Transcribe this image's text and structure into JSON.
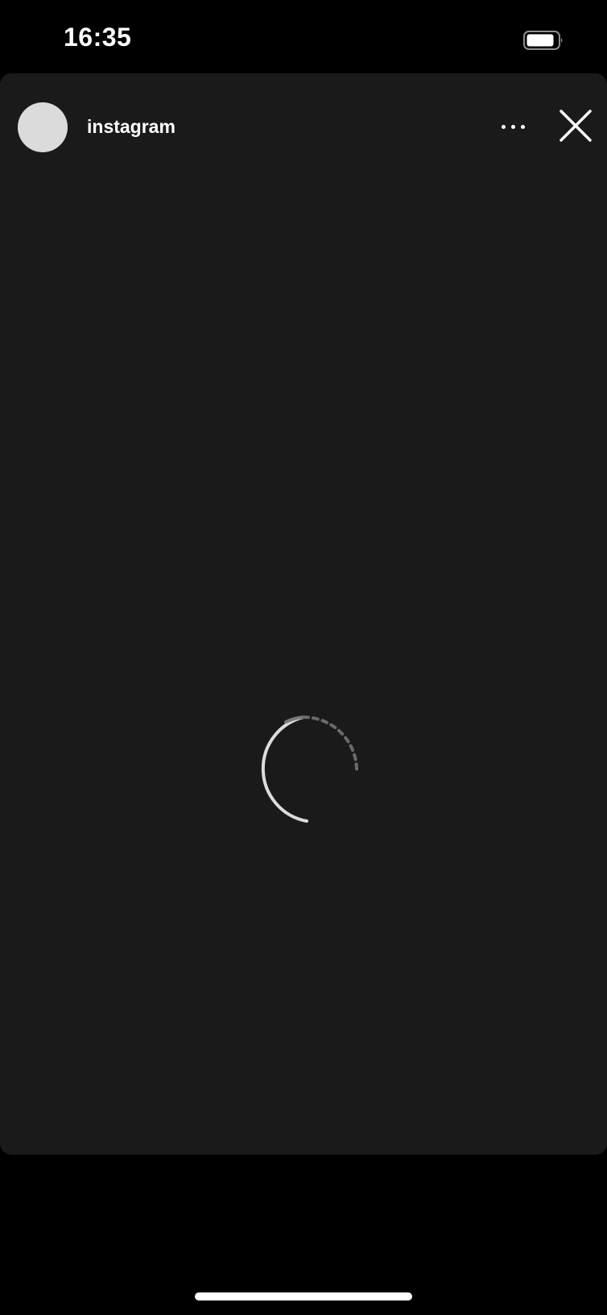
{
  "status_bar": {
    "time": "16:35",
    "battery_icon": "battery-icon"
  },
  "story": {
    "username": "instagram",
    "avatar_icon": "avatar",
    "more_icon": "more-horizontal-icon",
    "close_icon": "close-icon",
    "loading_icon": "loading-spinner-icon"
  },
  "colors": {
    "background": "#000000",
    "card": "#1a1a1a",
    "avatar_placeholder": "#dbdbdb",
    "text": "#ffffff"
  }
}
